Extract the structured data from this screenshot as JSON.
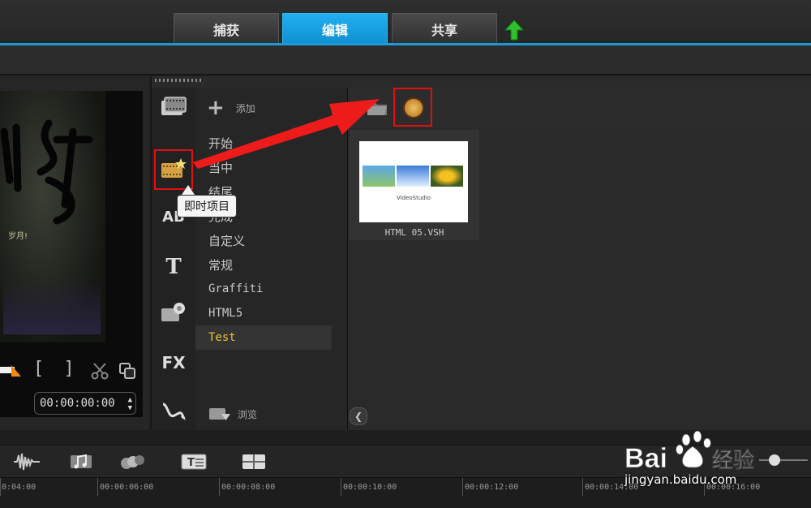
{
  "top_tabs": {
    "capture": "捕获",
    "edit": "编辑",
    "share": "共享"
  },
  "preview": {
    "timecode": "00:00:00:00",
    "bracket_in": "[",
    "bracket_out": "]",
    "video_caption": "岁月!"
  },
  "library": {
    "add_label": "添加",
    "browse_label": "浏览",
    "tooltip": "即时项目",
    "categories": [
      "开始",
      "当中",
      "结尾",
      "完成",
      "自定义",
      "常规",
      "Graffiti",
      "HTML5",
      "Test"
    ],
    "selected_category": "Test",
    "thumbnail": {
      "label": "HTML 05.VSH",
      "inner_caption": "VideoStudio"
    }
  },
  "timeline": {
    "ticks": [
      "0:04:00",
      "00:00:06:00",
      "00:00:08:00",
      "00:00:10:00",
      "00:00:12:00",
      "00:00:14:00",
      "00:00:16:00"
    ]
  },
  "watermark": {
    "logo": "Baidu经验",
    "url": "jingyan.baidu.com"
  },
  "colors": {
    "accent_blue": "#1c9ad6",
    "highlight_red": "#e01010",
    "selected_text": "#f0c030"
  },
  "icons": [
    "upload-arrow-icon",
    "video-icon",
    "instant-project-icon",
    "title-ab-icon",
    "text-t-icon",
    "graphic-flower-icon",
    "fx-icon",
    "path-icon",
    "folder-icon",
    "options-icon",
    "audio-wave-icon",
    "music-icon",
    "transition-icon",
    "subtitle-icon",
    "multi-track-icon"
  ]
}
